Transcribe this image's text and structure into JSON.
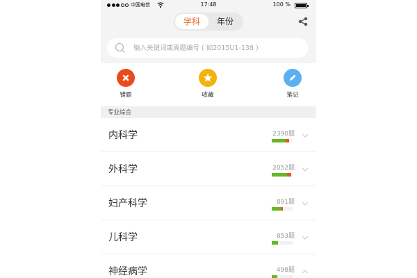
{
  "status_bar": {
    "carrier": "中国电信",
    "time": "17:48",
    "battery": "100 %"
  },
  "header": {
    "tabs": [
      {
        "label": "学科",
        "active": true
      },
      {
        "label": "年份",
        "active": false
      }
    ],
    "share_icon": "share-icon"
  },
  "search": {
    "placeholder": "输入关键词或真题编号 ( 如2015U1-138 )",
    "value": ""
  },
  "quick_actions": [
    {
      "label": "错题",
      "icon": "close-icon",
      "color": "#ea4b1c"
    },
    {
      "label": "收藏",
      "icon": "star-icon",
      "color": "#f2b20f"
    },
    {
      "label": "笔记",
      "icon": "pencil-icon",
      "color": "#5ab0f0"
    }
  ],
  "section": {
    "title": "专业综合"
  },
  "subjects": [
    {
      "name": "内科学",
      "count": "2390题",
      "correct": 0.65,
      "wrong": 0.18,
      "expanded": false
    },
    {
      "name": "外科学",
      "count": "2052题",
      "correct": 0.72,
      "wrong": 0.2,
      "expanded": false
    },
    {
      "name": "妇产科学",
      "count": "891题",
      "correct": 0.42,
      "wrong": 0.1,
      "expanded": false
    },
    {
      "name": "儿科学",
      "count": "853题",
      "correct": 0.3,
      "wrong": 0,
      "expanded": false
    },
    {
      "name": "神经病学",
      "count": "498题",
      "correct": 0.25,
      "wrong": 0,
      "expanded": true
    }
  ],
  "colors": {
    "accent": "#ea6b2e",
    "progress_correct": "#66b821",
    "progress_wrong": "#e25a2a"
  }
}
